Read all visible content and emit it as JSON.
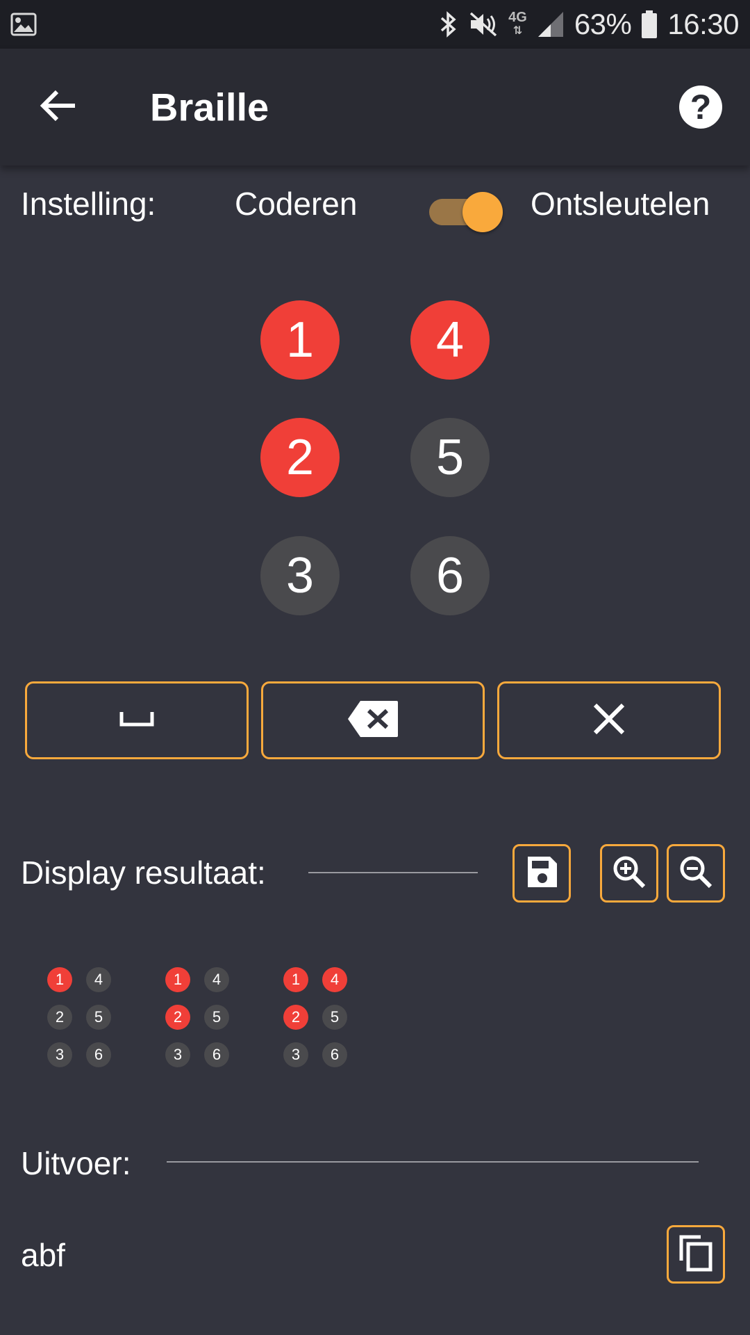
{
  "status_bar": {
    "battery": "63%",
    "time": "16:30",
    "network": "4G",
    "icons": [
      "image-icon",
      "bluetooth-icon",
      "mute-icon",
      "signal-icon",
      "battery-icon"
    ]
  },
  "app_bar": {
    "title": "Braille",
    "back_icon": "arrow-left-icon",
    "help_icon": "help-icon",
    "help_label": "?"
  },
  "settings": {
    "label": "Instelling:",
    "mode_left": "Coderen",
    "mode_right": "Ontsleutelen",
    "toggle_on": true
  },
  "braille_input": {
    "dots": [
      {
        "label": "1",
        "active": true
      },
      {
        "label": "2",
        "active": true
      },
      {
        "label": "3",
        "active": false
      },
      {
        "label": "4",
        "active": true
      },
      {
        "label": "5",
        "active": false
      },
      {
        "label": "6",
        "active": false
      }
    ]
  },
  "actions": [
    {
      "name": "space",
      "icon": "space-icon"
    },
    {
      "name": "backspace",
      "icon": "backspace-icon"
    },
    {
      "name": "clear",
      "icon": "close-icon"
    }
  ],
  "display": {
    "label": "Display resultaat:",
    "buttons": [
      "save-icon",
      "zoom-in-icon",
      "zoom-out-icon"
    ],
    "cells": [
      {
        "dots": [
          {
            "label": "1",
            "active": true
          },
          {
            "label": "2",
            "active": false
          },
          {
            "label": "3",
            "active": false
          },
          {
            "label": "4",
            "active": false
          },
          {
            "label": "5",
            "active": false
          },
          {
            "label": "6",
            "active": false
          }
        ]
      },
      {
        "dots": [
          {
            "label": "1",
            "active": true
          },
          {
            "label": "2",
            "active": true
          },
          {
            "label": "3",
            "active": false
          },
          {
            "label": "4",
            "active": false
          },
          {
            "label": "5",
            "active": false
          },
          {
            "label": "6",
            "active": false
          }
        ]
      },
      {
        "dots": [
          {
            "label": "1",
            "active": true
          },
          {
            "label": "2",
            "active": true
          },
          {
            "label": "3",
            "active": false
          },
          {
            "label": "4",
            "active": true
          },
          {
            "label": "5",
            "active": false
          },
          {
            "label": "6",
            "active": false
          }
        ]
      }
    ]
  },
  "output": {
    "label": "Uitvoer:",
    "value": "abf",
    "copy_icon": "copy-icon"
  },
  "colors": {
    "accent": "#f9a93c",
    "dot_active": "#f03f38",
    "dot_inactive": "#4a4a4d",
    "background": "#33343e",
    "app_bar": "#2a2b33"
  }
}
